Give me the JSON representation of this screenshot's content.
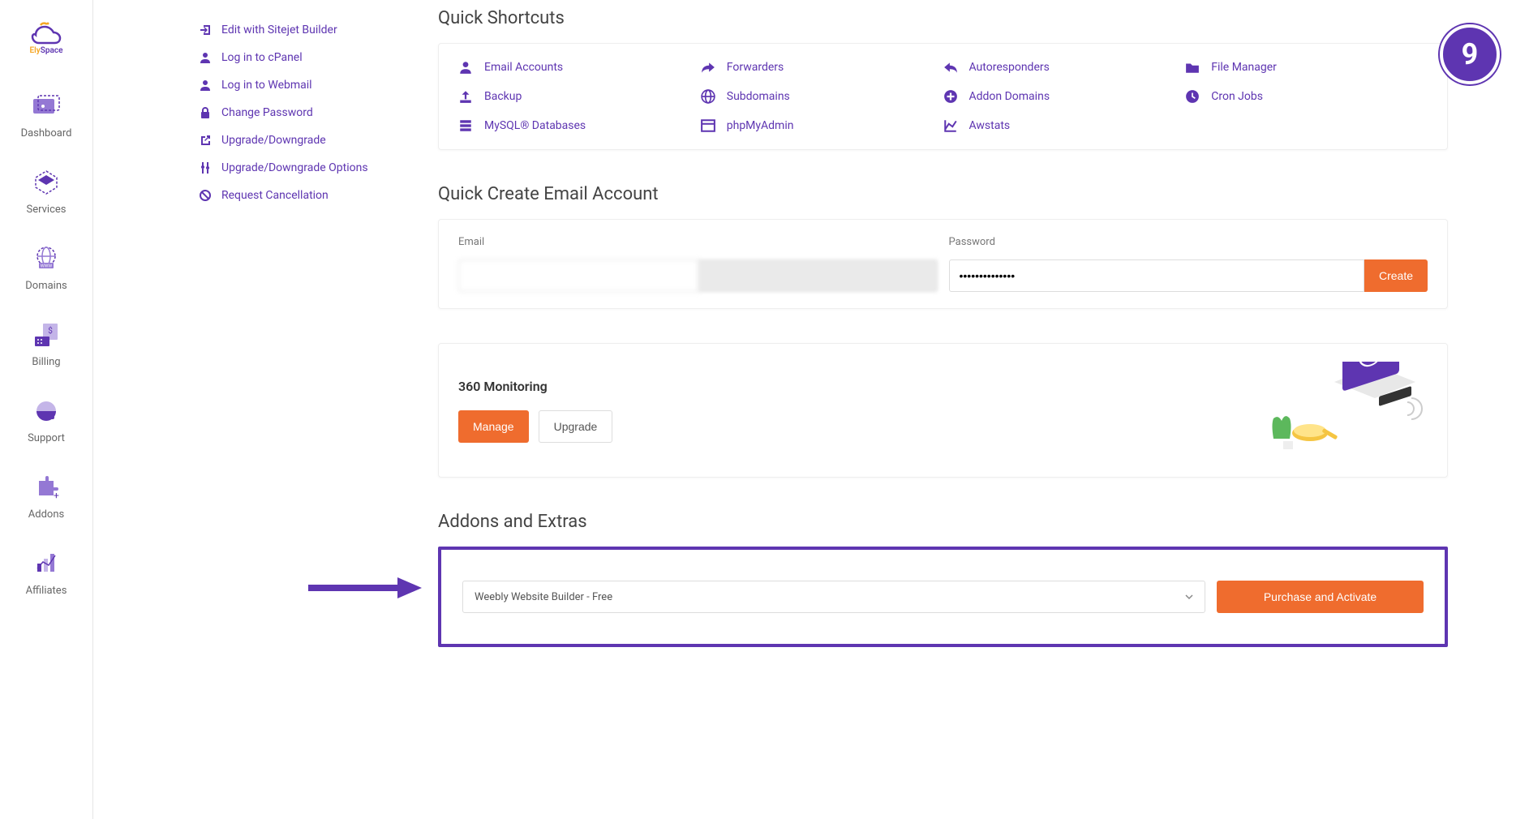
{
  "brand": {
    "name_left": "Ely",
    "name_right": "Space"
  },
  "nav": [
    {
      "label": "Dashboard",
      "icon": "dashboard"
    },
    {
      "label": "Services",
      "icon": "services"
    },
    {
      "label": "Domains",
      "icon": "domains"
    },
    {
      "label": "Billing",
      "icon": "billing"
    },
    {
      "label": "Support",
      "icon": "support"
    },
    {
      "label": "Addons",
      "icon": "addons"
    },
    {
      "label": "Affiliates",
      "icon": "affiliates"
    }
  ],
  "actions": [
    {
      "label": "Edit with Sitejet Builder",
      "icon": "login"
    },
    {
      "label": "Log in to cPanel",
      "icon": "person"
    },
    {
      "label": "Log in to Webmail",
      "icon": "person"
    },
    {
      "label": "Change Password",
      "icon": "lock"
    },
    {
      "label": "Upgrade/Downgrade",
      "icon": "external"
    },
    {
      "label": "Upgrade/Downgrade Options",
      "icon": "sliders"
    },
    {
      "label": "Request Cancellation",
      "icon": "forbid"
    }
  ],
  "shortcuts_title": "Quick Shortcuts",
  "shortcuts": [
    {
      "label": "Email Accounts",
      "icon": "person"
    },
    {
      "label": "Forwarders",
      "icon": "share"
    },
    {
      "label": "Autoresponders",
      "icon": "reply"
    },
    {
      "label": "File Manager",
      "icon": "folder"
    },
    {
      "label": "Backup",
      "icon": "upload"
    },
    {
      "label": "Subdomains",
      "icon": "globe"
    },
    {
      "label": "Addon Domains",
      "icon": "pluscircle"
    },
    {
      "label": "Cron Jobs",
      "icon": "clock"
    },
    {
      "label": "MySQL® Databases",
      "icon": "db"
    },
    {
      "label": "phpMyAdmin",
      "icon": "window"
    },
    {
      "label": "Awstats",
      "icon": "chart"
    }
  ],
  "email_section_title": "Quick Create Email Account",
  "email_label": "Email",
  "password_label": "Password",
  "email_value": "",
  "domain_value": "",
  "password_value": "••••••••••••••",
  "create_btn": "Create",
  "monitoring": {
    "title": "360 Monitoring",
    "manage_btn": "Manage",
    "upgrade_btn": "Upgrade"
  },
  "addons_title": "Addons and Extras",
  "addons": {
    "select_value": "Weebly Website Builder - Free",
    "purchase_btn": "Purchase and Activate"
  },
  "step_number": "9"
}
